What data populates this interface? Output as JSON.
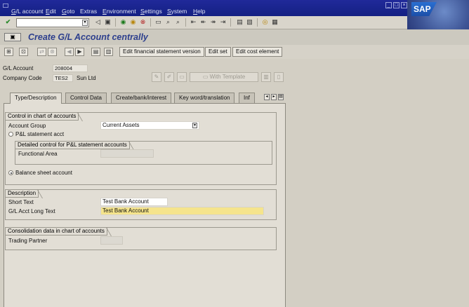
{
  "menubar": {
    "items": [
      {
        "pre": "G",
        "rest": "/L account"
      },
      {
        "pre": "E",
        "rest": "dit"
      },
      {
        "pre": "G",
        "rest": "oto"
      },
      {
        "pre": "",
        "rest": "Extras"
      },
      {
        "pre": "E",
        "rest": "nvironment"
      },
      {
        "pre": "S",
        "rest": "ettings"
      },
      {
        "pre": "S",
        "rest": "ystem"
      },
      {
        "pre": "H",
        "rest": "elp"
      }
    ],
    "logo": "SAP"
  },
  "title": "Create G/L Account centrally",
  "app_toolbar": {
    "edit_fs_version": "Edit financial statement version",
    "edit_set": "Edit set",
    "edit_cost_element": "Edit cost element"
  },
  "header": {
    "gl_account_label": "G/L Account",
    "gl_account_value": "208004",
    "company_code_label": "Company Code",
    "company_code_value": "TES2",
    "company_name": "Sun Ltd",
    "with_template": "With Template"
  },
  "tabs": [
    {
      "label": "Type/Description",
      "active": true
    },
    {
      "label": "Control Data",
      "active": false
    },
    {
      "label": "Create/bank/interest",
      "active": false
    },
    {
      "label": "Key word/translation",
      "active": false
    },
    {
      "label": "Inf",
      "active": false
    }
  ],
  "control_group": {
    "title": "Control in chart of accounts",
    "account_group_label": "Account Group",
    "account_group_value": "Current Assets",
    "pl_label": "P&L statement acct",
    "pl_checked": false,
    "detailed_title": "Detailed control for P&L statement accounts",
    "functional_area_label": "Functional Area",
    "functional_area_value": "",
    "balance_label": "Balance sheet account",
    "balance_checked": true
  },
  "description_group": {
    "title": "Description",
    "short_text_label": "Short Text",
    "short_text_value": "Test Bank Account",
    "long_text_label": "G/L Acct Long Text",
    "long_text_value": "Test Bank Account"
  },
  "consolidation_group": {
    "title": "Consolidation data in chart of accounts",
    "trading_partner_label": "Trading Partner",
    "trading_partner_value": ""
  }
}
